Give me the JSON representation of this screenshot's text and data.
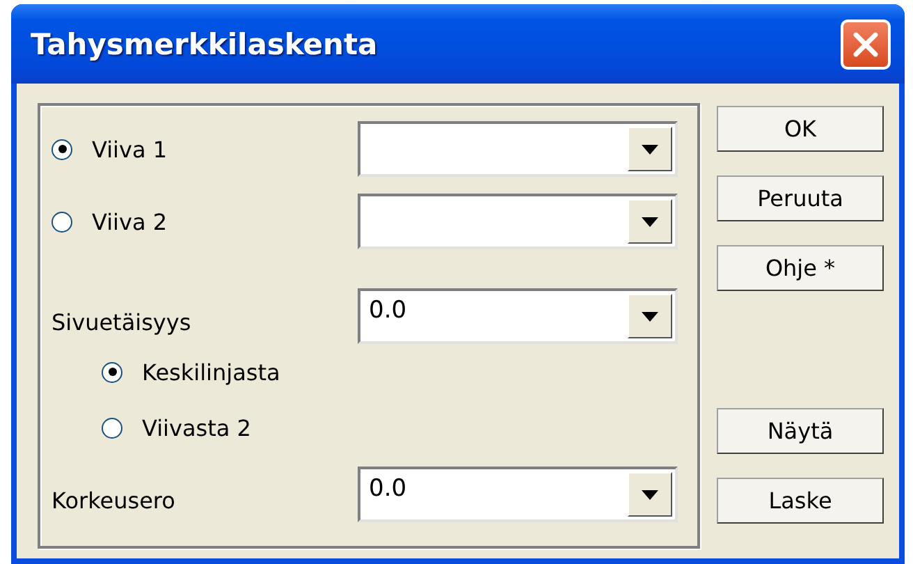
{
  "window": {
    "title": "Tahysmerkkilaskenta"
  },
  "lines": [
    {
      "label": "Viiva 1",
      "selected": true
    },
    {
      "label": "Viiva 2",
      "selected": false
    }
  ],
  "offset": {
    "label": "Sivuetäisyys",
    "value": "0.0",
    "options": [
      {
        "label": "Keskilinjasta",
        "selected": true
      },
      {
        "label": "Viivasta 2",
        "selected": false
      }
    ]
  },
  "height_difference": {
    "label": "Korkeusero",
    "value": "0.0"
  },
  "buttons_top": [
    "OK",
    "Peruuta",
    "Ohje *"
  ],
  "buttons_bottom": [
    "Näytä",
    "Laske"
  ]
}
